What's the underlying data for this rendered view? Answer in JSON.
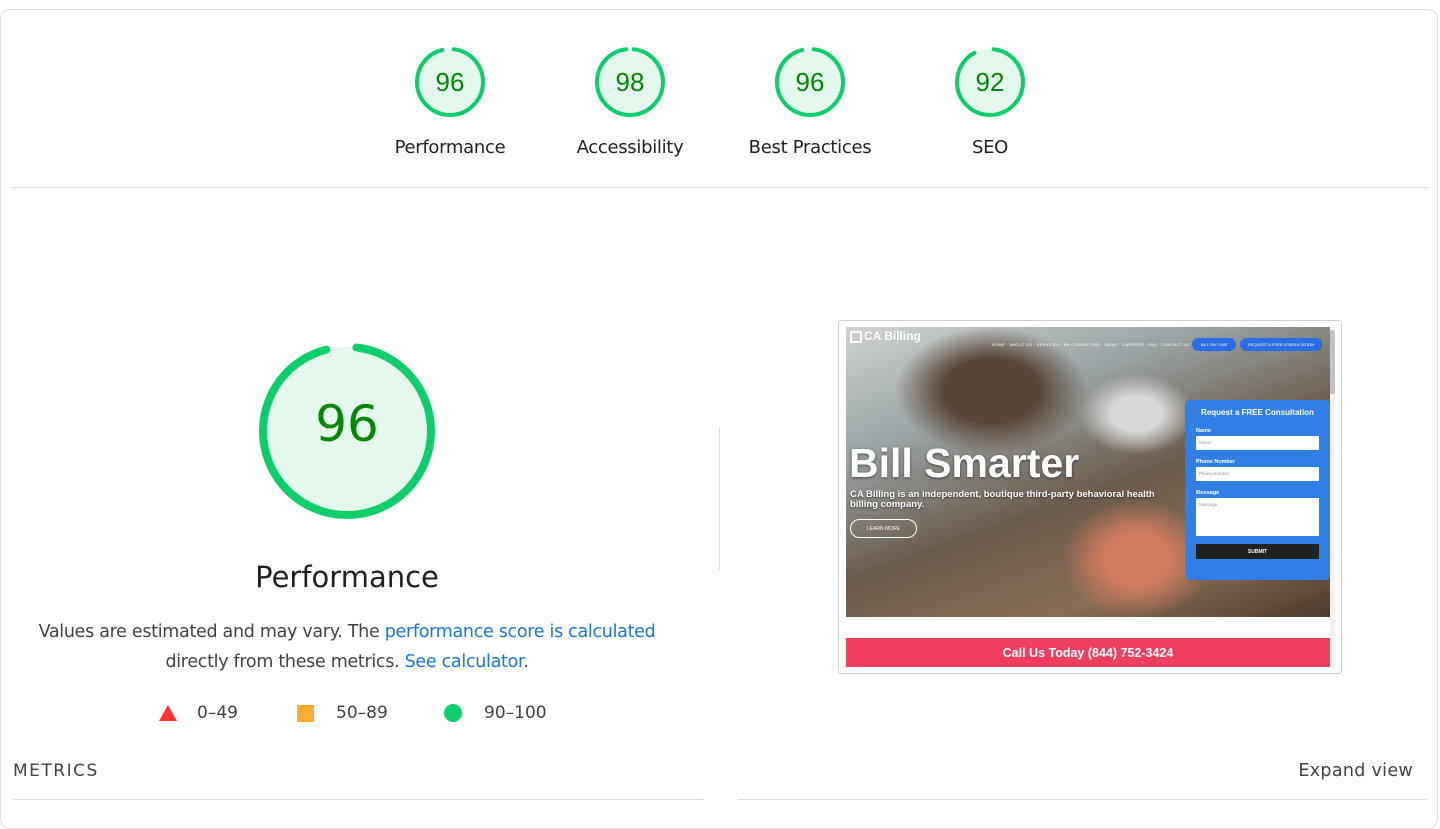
{
  "categories": [
    {
      "label": "Performance",
      "score": 96
    },
    {
      "label": "Accessibility",
      "score": 98
    },
    {
      "label": "Best Practices",
      "score": 96
    },
    {
      "label": "SEO",
      "score": 92
    }
  ],
  "colors": {
    "pass": "#0cce6b",
    "pass_text": "#008800",
    "pass_fill": "#e5f8ee",
    "average": "#ffaa33",
    "fail": "#ff3333",
    "link": "#1a73e8"
  },
  "main": {
    "score": 96,
    "title": "Performance",
    "desc_1": "Values are estimated and may vary. The ",
    "link_1": "performance score is calculated",
    "desc_2": "directly from these metrics. ",
    "link_2": "See calculator",
    "desc_3": "."
  },
  "legend": [
    {
      "icon": "triangle-fail",
      "range": "0–49"
    },
    {
      "icon": "square-average",
      "range": "50–89"
    },
    {
      "icon": "circle-pass",
      "range": "90–100"
    }
  ],
  "screenshot": {
    "logo": "CA Billing",
    "nav": "HOME · ABOUT US · SERVICES · BH CONSULTING · NEWS · CAREERS · FAQ · CONTACT US",
    "pill_1": "BILL PAY CMS",
    "pill_2": "REQUEST A FREE CONSULTATION",
    "headline": "Bill Smarter",
    "subtext": "CA Billing is an independent, boutique third-party behavioral health billing company.",
    "learn_more": "LEARN MORE",
    "form_title": "Request a FREE Consultation",
    "name_label": "Name",
    "name_placeholder": "Name",
    "phone_label": "Phone Number",
    "phone_placeholder": "Phone Number",
    "message_label": "Message",
    "message_placeholder": "Message",
    "submit": "SUBMIT",
    "callbar": "Call Us Today (844) 752-3424"
  },
  "metrics_title": "METRICS",
  "expand_view": "Expand view"
}
